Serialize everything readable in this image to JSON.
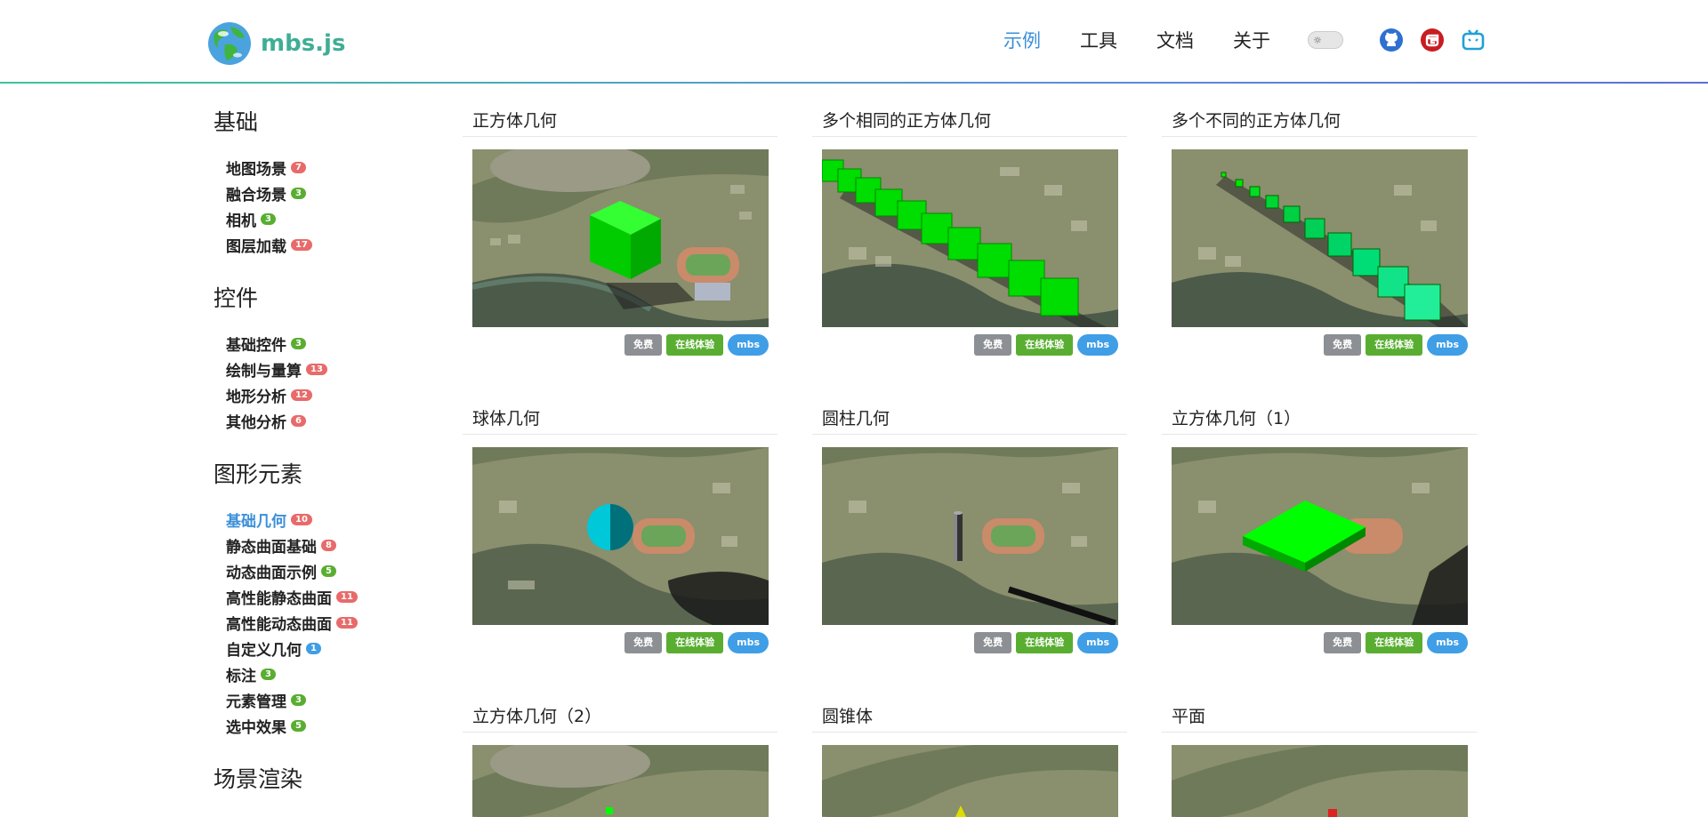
{
  "header": {
    "logo_text": "mbs.js",
    "nav": [
      {
        "label": "示例",
        "active": true
      },
      {
        "label": "工具",
        "active": false
      },
      {
        "label": "文档",
        "active": false
      },
      {
        "label": "关于",
        "active": false
      }
    ],
    "theme_icon": "sun-icon",
    "social_icons": [
      "github-icon",
      "gitee-icon",
      "bilibili-icon"
    ]
  },
  "colors": {
    "accent": "#3b8fd9",
    "logo": "#3fae95",
    "badge_red": "#e05d5d",
    "badge_green": "#59ae31",
    "badge_blue": "#3f9ee6",
    "geometry_green": "#00ff00"
  },
  "sidebar": [
    {
      "title": "基础",
      "items": [
        {
          "label": "地图场景",
          "count": "7",
          "color": "red"
        },
        {
          "label": "融合场景",
          "count": "3",
          "color": "green"
        },
        {
          "label": "相机",
          "count": "3",
          "color": "green"
        },
        {
          "label": "图层加载",
          "count": "17",
          "color": "red"
        }
      ]
    },
    {
      "title": "控件",
      "items": [
        {
          "label": "基础控件",
          "count": "3",
          "color": "green"
        },
        {
          "label": "绘制与量算",
          "count": "13",
          "color": "red"
        },
        {
          "label": "地形分析",
          "count": "12",
          "color": "red"
        },
        {
          "label": "其他分析",
          "count": "6",
          "color": "red"
        }
      ]
    },
    {
      "title": "图形元素",
      "items": [
        {
          "label": "基础几何",
          "count": "10",
          "color": "red",
          "active": true
        },
        {
          "label": "静态曲面基础",
          "count": "8",
          "color": "red"
        },
        {
          "label": "动态曲面示例",
          "count": "5",
          "color": "green"
        },
        {
          "label": "高性能静态曲面",
          "count": "11",
          "color": "red"
        },
        {
          "label": "高性能动态曲面",
          "count": "11",
          "color": "red"
        },
        {
          "label": "自定义几何",
          "count": "1",
          "color": "blue"
        },
        {
          "label": "标注",
          "count": "3",
          "color": "green"
        },
        {
          "label": "元素管理",
          "count": "3",
          "color": "green"
        },
        {
          "label": "选中效果",
          "count": "5",
          "color": "green"
        }
      ]
    },
    {
      "title": "场景渲染",
      "items": []
    }
  ],
  "cards": [
    {
      "title": "正方体几何",
      "scene": "single-cube"
    },
    {
      "title": "多个相同的正方体几何",
      "scene": "cube-row-same"
    },
    {
      "title": "多个不同的正方体几何",
      "scene": "cube-row-different"
    },
    {
      "title": "球体几何",
      "scene": "sphere"
    },
    {
      "title": "圆柱几何",
      "scene": "cylinder"
    },
    {
      "title": "立方体几何（1）",
      "scene": "box-flat"
    },
    {
      "title": "立方体几何（2）",
      "scene": "partial"
    },
    {
      "title": "圆锥体",
      "scene": "partial"
    },
    {
      "title": "平面",
      "scene": "partial"
    }
  ],
  "tags": {
    "free": "免费",
    "online": "在线体验",
    "mbs": "mbs"
  }
}
